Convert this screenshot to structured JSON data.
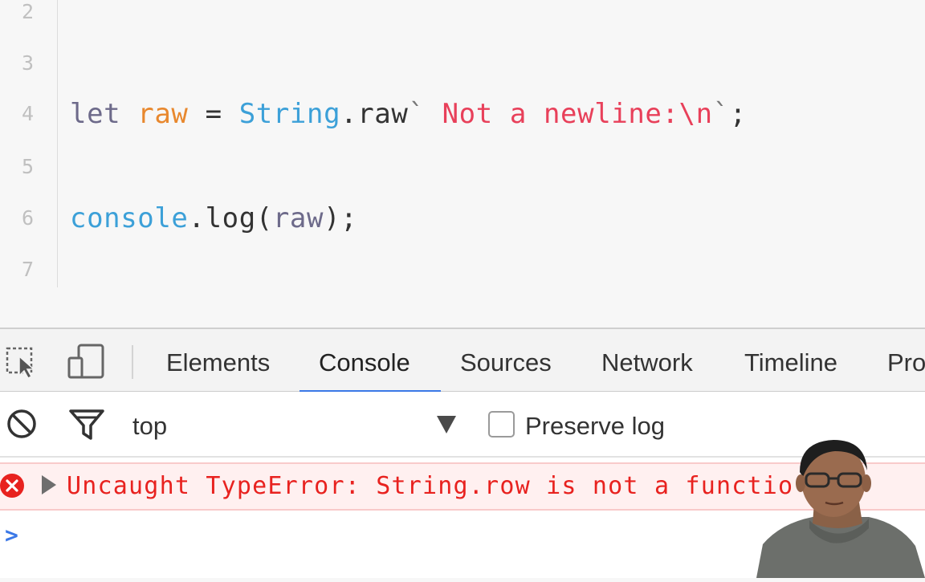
{
  "editor": {
    "lines": [
      {
        "num": "2",
        "tokens": []
      },
      {
        "num": "3",
        "tokens": []
      },
      {
        "num": "4",
        "tokens": [
          {
            "text": "let ",
            "color": "#6d6a8a"
          },
          {
            "text": "raw",
            "color": "#e8882e"
          },
          {
            "text": " = ",
            "color": "#333333"
          },
          {
            "text": "String",
            "color": "#3ca0d8"
          },
          {
            "text": ".raw",
            "color": "#333333"
          },
          {
            "text": "` ",
            "color": "#777777"
          },
          {
            "text": "Not a newline:\\n",
            "color": "#e8405a"
          },
          {
            "text": "`",
            "color": "#777777"
          },
          {
            "text": ";",
            "color": "#333333"
          }
        ]
      },
      {
        "num": "5",
        "tokens": []
      },
      {
        "num": "6",
        "tokens": [
          {
            "text": "console",
            "color": "#3ca0d8"
          },
          {
            "text": ".log(",
            "color": "#333333"
          },
          {
            "text": "raw",
            "color": "#6d6a8a"
          },
          {
            "text": ");",
            "color": "#333333"
          }
        ]
      },
      {
        "num": "7",
        "tokens": []
      }
    ]
  },
  "devtools": {
    "tabs": [
      {
        "label": "Elements",
        "active": false
      },
      {
        "label": "Console",
        "active": true
      },
      {
        "label": "Sources",
        "active": false
      },
      {
        "label": "Network",
        "active": false
      },
      {
        "label": "Timeline",
        "active": false
      },
      {
        "label": "Pro",
        "active": false
      }
    ],
    "icons": {
      "inspect": "inspect-element-icon",
      "device": "device-toolbar-icon",
      "clear": "clear-console-icon",
      "filter": "filter-icon",
      "error": "error-icon",
      "expand": "expand-arrow-icon"
    },
    "filter_bar": {
      "context": "top",
      "preserve_log_label": "Preserve log",
      "preserve_log_checked": false
    },
    "console": {
      "error_message": "Uncaught TypeError: String.row is not a functio",
      "prompt_symbol": ">"
    }
  },
  "colors": {
    "error_red": "#e8221f",
    "accent_blue": "#3b78e7",
    "editor_bg": "#f7f7f7"
  }
}
